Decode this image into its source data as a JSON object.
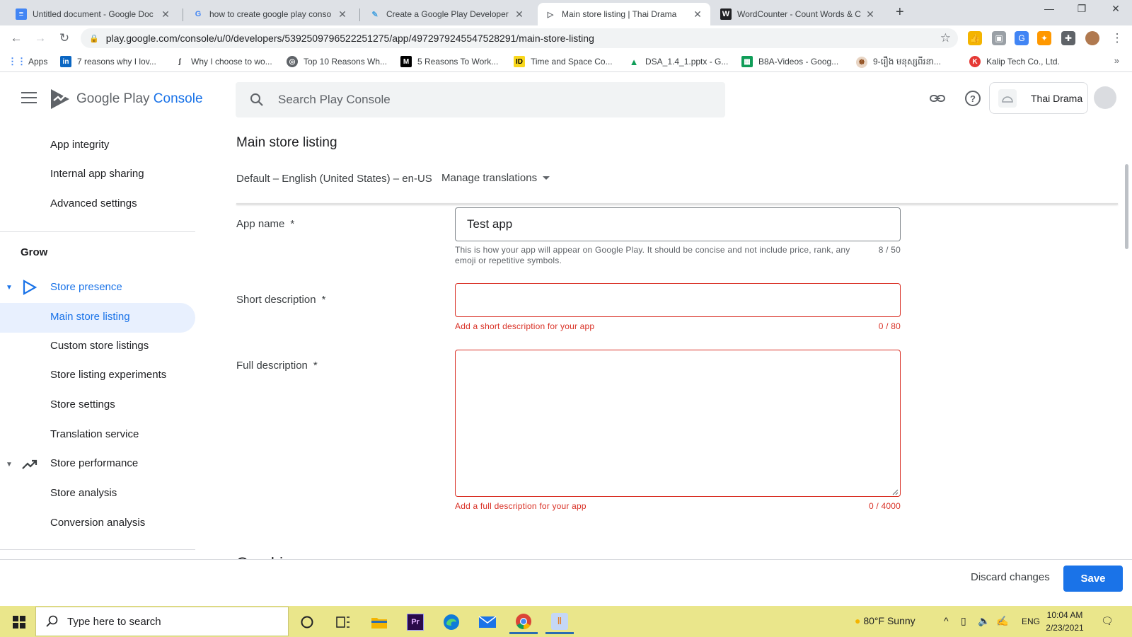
{
  "browser": {
    "tabs": [
      {
        "title": "Untitled document - Google Doc",
        "favicon": "docs-icon",
        "active": false
      },
      {
        "title": "how to create google play conso",
        "favicon": "google-icon",
        "active": false
      },
      {
        "title": "Create a Google Play Developer",
        "favicon": "feather-icon",
        "active": false
      },
      {
        "title": "Main store listing | Thai Drama",
        "favicon": "play-console-icon",
        "active": true
      },
      {
        "title": "WordCounter - Count Words & C",
        "favicon": "w-icon",
        "active": false
      }
    ],
    "url": "play.google.com/console/u/0/developers/5392509796522251275/app/4972979245547528291/main-store-listing",
    "bookmarks": [
      {
        "label": "Apps",
        "icon": "apps-grid-icon"
      },
      {
        "label": "7 reasons why I lov...",
        "icon": "linkedin-icon"
      },
      {
        "label": "Why I choose to wo...",
        "icon": "fastcompany-icon"
      },
      {
        "label": "Top 10 Reasons Wh...",
        "icon": "globe-icon"
      },
      {
        "label": "5 Reasons To Work...",
        "icon": "medium-icon"
      },
      {
        "label": "Time and Space Co...",
        "icon": "id-icon"
      },
      {
        "label": "DSA_1.4_1.pptx - G...",
        "icon": "drive-icon"
      },
      {
        "label": "B8A-Videos - Goog...",
        "icon": "sheets-icon"
      },
      {
        "label": "9-រឿង មនុស្សពីរនា...",
        "icon": "khmer-site-icon"
      },
      {
        "label": "Kalip Tech Co., Ltd.",
        "icon": "kalip-icon"
      }
    ],
    "bookmarks_more": "»"
  },
  "console": {
    "logo_text_google_play": "Google Play",
    "logo_text_console": "Console",
    "search_placeholder": "Search Play Console",
    "developer_name": "Thai Drama"
  },
  "sidebar": {
    "items_top": [
      {
        "label": "App integrity"
      },
      {
        "label": "Internal app sharing"
      },
      {
        "label": "Advanced settings"
      }
    ],
    "grow_heading": "Grow",
    "store_presence": {
      "label": "Store presence",
      "children": [
        {
          "label": "Main store listing",
          "active": true
        },
        {
          "label": "Custom store listings"
        },
        {
          "label": "Store listing experiments"
        },
        {
          "label": "Store settings"
        },
        {
          "label": "Translation service"
        }
      ]
    },
    "store_performance": {
      "label": "Store performance",
      "children": [
        {
          "label": "Store analysis"
        },
        {
          "label": "Conversion analysis"
        }
      ]
    }
  },
  "main": {
    "title": "Main store listing",
    "language": "Default – English (United States) – en-US",
    "manage_translations": "Manage translations",
    "fields": {
      "app_name": {
        "label": "App name",
        "required_mark": "*",
        "value": "Test app",
        "helper": "This is how your app will appear on Google Play. It should be concise and not include price, rank, any emoji or repetitive symbols.",
        "counter": "8 / 50"
      },
      "short_description": {
        "label": "Short description",
        "required_mark": "*",
        "value": "",
        "error": "Add a short description for your app",
        "counter": "0 / 80"
      },
      "full_description": {
        "label": "Full description",
        "required_mark": "*",
        "value": "",
        "error": "Add a full description for your app",
        "counter": "0 / 4000"
      }
    },
    "next_section_title": "Graphics"
  },
  "footer": {
    "discard_label": "Discard changes",
    "save_label": "Save"
  },
  "taskbar": {
    "search_placeholder": "Type here to search",
    "weather": "80°F  Sunny",
    "language": "ENG",
    "time": "10:04 AM",
    "date": "2/23/2021"
  },
  "colors": {
    "accent": "#1a73e8",
    "error": "#d93025",
    "active_nav_bg": "#e8f0fe",
    "taskbar": "#eae68b"
  }
}
